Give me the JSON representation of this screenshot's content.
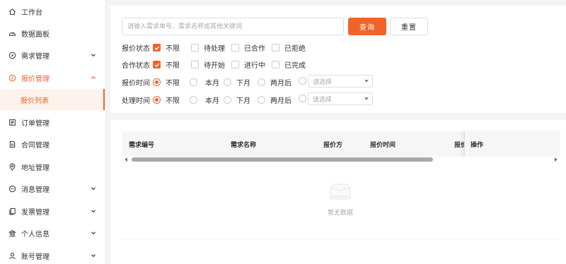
{
  "sidebar": {
    "items": [
      {
        "label": "工作台",
        "icon": "home-icon"
      },
      {
        "label": "数据面板",
        "icon": "dashboard-icon"
      },
      {
        "label": "需求管理",
        "icon": "compass-icon",
        "expandable": true,
        "expanded": false
      },
      {
        "label": "报价管理",
        "icon": "dollar-icon",
        "expandable": true,
        "expanded": true,
        "active": true
      },
      {
        "label": "订单管理",
        "icon": "list-icon"
      },
      {
        "label": "合同管理",
        "icon": "document-icon"
      },
      {
        "label": "地址管理",
        "icon": "location-icon"
      },
      {
        "label": "消息管理",
        "icon": "chat-icon",
        "expandable": true,
        "expanded": false
      },
      {
        "label": "发票管理",
        "icon": "invoice-icon",
        "expandable": true,
        "expanded": false
      },
      {
        "label": "个人信息",
        "icon": "bank-icon",
        "expandable": true,
        "expanded": false
      },
      {
        "label": "账号管理",
        "icon": "user-icon",
        "expandable": true,
        "expanded": false
      }
    ],
    "sub_item": {
      "label": "报价列表",
      "active": true
    }
  },
  "search": {
    "placeholder": "请输入需求单号、需求名称或其他关键词",
    "value": "",
    "query_label": "查询",
    "reset_label": "重置"
  },
  "filters": {
    "quote_status": {
      "label": "报价状态",
      "options": [
        {
          "label": "不限",
          "checked": true
        },
        {
          "label": "待处理",
          "checked": false
        },
        {
          "label": "已合作",
          "checked": false
        },
        {
          "label": "已拒绝",
          "checked": false
        }
      ]
    },
    "coop_status": {
      "label": "合作状态",
      "options": [
        {
          "label": "不限",
          "checked": true
        },
        {
          "label": "待开始",
          "checked": false
        },
        {
          "label": "进行中",
          "checked": false
        },
        {
          "label": "已完成",
          "checked": false
        }
      ]
    },
    "quote_time": {
      "label": "报价时间",
      "options": [
        {
          "label": "不限",
          "checked": true
        },
        {
          "label": "本月",
          "checked": false
        },
        {
          "label": "下月",
          "checked": false
        },
        {
          "label": "两月后",
          "checked": false
        }
      ],
      "select_placeholder": "请选择"
    },
    "process_time": {
      "label": "处理时间",
      "options": [
        {
          "label": "不限",
          "checked": true
        },
        {
          "label": "本月",
          "checked": false
        },
        {
          "label": "下月",
          "checked": false
        },
        {
          "label": "两月后",
          "checked": false
        }
      ],
      "select_placeholder": "请选择"
    }
  },
  "table": {
    "columns": [
      "需求编号",
      "需求名称",
      "报价方",
      "报价时间",
      "报价"
    ],
    "fixed_column": "操作",
    "rows": [],
    "empty_text": "暂无数据"
  },
  "colors": {
    "accent": "#f0642b",
    "sidebar_active_bg": "#fdf2ec",
    "page_bg": "#f2f3f5",
    "table_header_bg": "#f5f6f8"
  }
}
